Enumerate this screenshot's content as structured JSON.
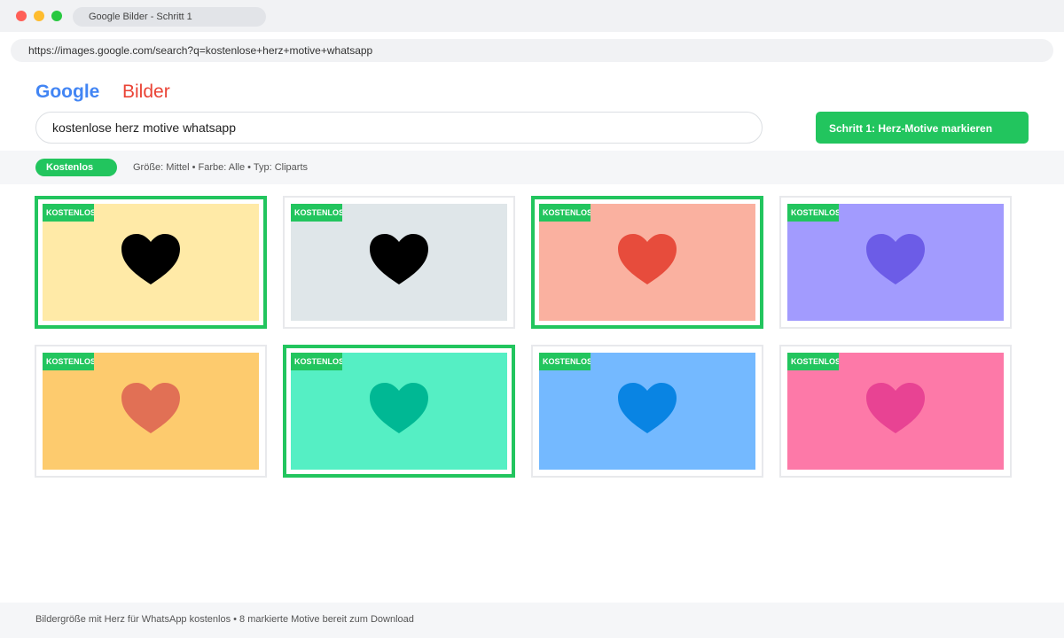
{
  "window": {
    "tab_title": "Google Bilder - Schritt 1",
    "url": "https://images.google.com/search?q=kostenlose+herz+motive+whatsapp"
  },
  "header": {
    "logo_google": "Google",
    "logo_bilder": "Bilder",
    "search_query": "kostenlose herz motive whatsapp",
    "step_button": "Schritt 1: Herz-Motive markieren"
  },
  "filters": {
    "chip": "Kostenlos",
    "details": "Größe: Mittel • Farbe: Alle • Typ: Cliparts"
  },
  "colors": {
    "accent": "#22c55e",
    "google_blue": "#4285f4",
    "bilder_red": "#ea4335"
  },
  "results": [
    {
      "badge": "KOSTENLOS",
      "marked": true,
      "bg": "#ffeaa7",
      "heart": "#000000",
      "icon": "heart-icon"
    },
    {
      "badge": "KOSTENLOS",
      "marked": false,
      "bg": "#dfe6e9",
      "heart": "#000000",
      "icon": "heart-icon"
    },
    {
      "badge": "KOSTENLOS",
      "marked": true,
      "bg": "#fab1a0",
      "heart": "#e74c3c",
      "icon": "heart-icon"
    },
    {
      "badge": "KOSTENLOS",
      "marked": false,
      "bg": "#a29bfe",
      "heart": "#6c5ce7",
      "icon": "heart-icon"
    },
    {
      "badge": "KOSTENLOS",
      "marked": false,
      "bg": "#fdcb6e",
      "heart": "#e17055",
      "icon": "heart-icon"
    },
    {
      "badge": "KOSTENLOS",
      "marked": true,
      "bg": "#55efc4",
      "heart": "#00b894",
      "icon": "heart-icon"
    },
    {
      "badge": "KOSTENLOS",
      "marked": false,
      "bg": "#74b9ff",
      "heart": "#0984e3",
      "icon": "heart-icon"
    },
    {
      "badge": "KOSTENLOS",
      "marked": false,
      "bg": "#fd79a8",
      "heart": "#e84393",
      "icon": "heart-icon"
    }
  ],
  "footer": {
    "text": "Bildergröße mit Herz für WhatsApp kostenlos • 8 markierte Motive bereit zum Download"
  }
}
